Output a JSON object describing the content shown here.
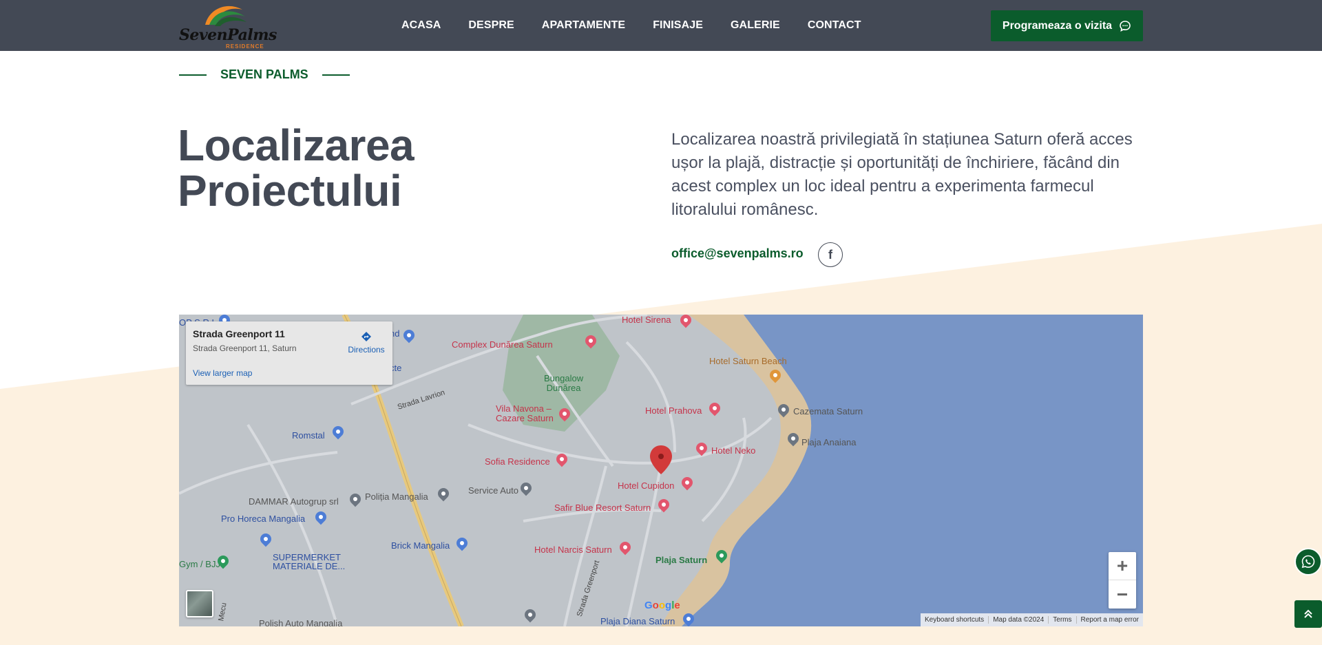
{
  "header": {
    "logo": {
      "text": "SevenPalms",
      "sub": "RESIDENCE"
    },
    "nav": [
      {
        "label": "ACASA"
      },
      {
        "label": "DESPRE"
      },
      {
        "label": "APARTAMENTE"
      },
      {
        "label": "FINISAJE"
      },
      {
        "label": "GALERIE"
      },
      {
        "label": "CONTACT"
      }
    ],
    "cta_label": "Programeaza o vizita",
    "cta_icon": "chat-bubble-icon"
  },
  "section": {
    "eyebrow": "SEVEN PALMS",
    "title_line1": "Localizarea",
    "title_line2": "Proiectului",
    "description": "Localizarea noastră privilegiată în stațiunea Saturn oferă acces ușor la plajă, distracție și oportunități de închiriere, făcând din acest complex un loc ideal pentru a experimenta farmecul litoralului românesc.",
    "email": "office@sevenpalms.ro",
    "facebook_icon": "facebook-icon"
  },
  "map": {
    "info_title": "Strada Greenport 11",
    "info_address": "Strada Greenport 11, Saturn",
    "view_larger": "View larger map",
    "directions": "Directions",
    "labels": {
      "hotel_sirena": "Hotel Sirena",
      "complex_dunarea": "Complex Dunărea Saturn",
      "hotel_saturn_beach": "Hotel Saturn Beach",
      "bungalow_dunarea": "Bungalow\nDunărea",
      "strada_lavrion": "Strada Lavrion",
      "vila_navona": "Vila Navona –\nCazare Saturn",
      "hotel_prahova": "Hotel Prahova",
      "cazemata_saturn": "Cazemata Saturn",
      "romstal": "Romstal",
      "plaja_anaiana": "Plaja Anaiana",
      "hotel_neko": "Hotel Neko",
      "sofia_residence": "Sofia Residence",
      "dammar": "DAMMAR Autogrup srl",
      "politia": "Poliția Mangalia",
      "service_auto": "Service Auto",
      "hotel_cupidon": "Hotel Cupidon",
      "pro_horeca": "Pro Horeca Mangalia",
      "safir_blue": "Safir Blue Resort Saturn",
      "brick_mangalia": "Brick Mangalia",
      "hotel_narcis": "Hotel Narcis Saturn",
      "plaja_saturn": "Plaja Saturn",
      "gym": "Gym / BJJ",
      "supermarket": "SUPERMERKET\nMATERIALE DE...",
      "polish_auto": "Polish Auto Mangalia",
      "plaja_diana": "Plaja Diana Saturn",
      "strada_greenport": "Strada Greenport",
      "mecu": "Mecu",
      "partial_nd": "nd",
      "partial_cte": "cte",
      "partial_srl": "OP S.R.L."
    },
    "google": "Google",
    "attribution": [
      "Keyboard shortcuts",
      "Map data ©2024",
      "Terms",
      "Report a map error"
    ],
    "zoom_in": "+",
    "zoom_out": "−"
  },
  "colors": {
    "header_bg": "#434955",
    "brand_green": "#0b5c2c",
    "cream": "#fdf1e0",
    "map_water": "#7895c6",
    "map_land": "#bfc4c9"
  }
}
